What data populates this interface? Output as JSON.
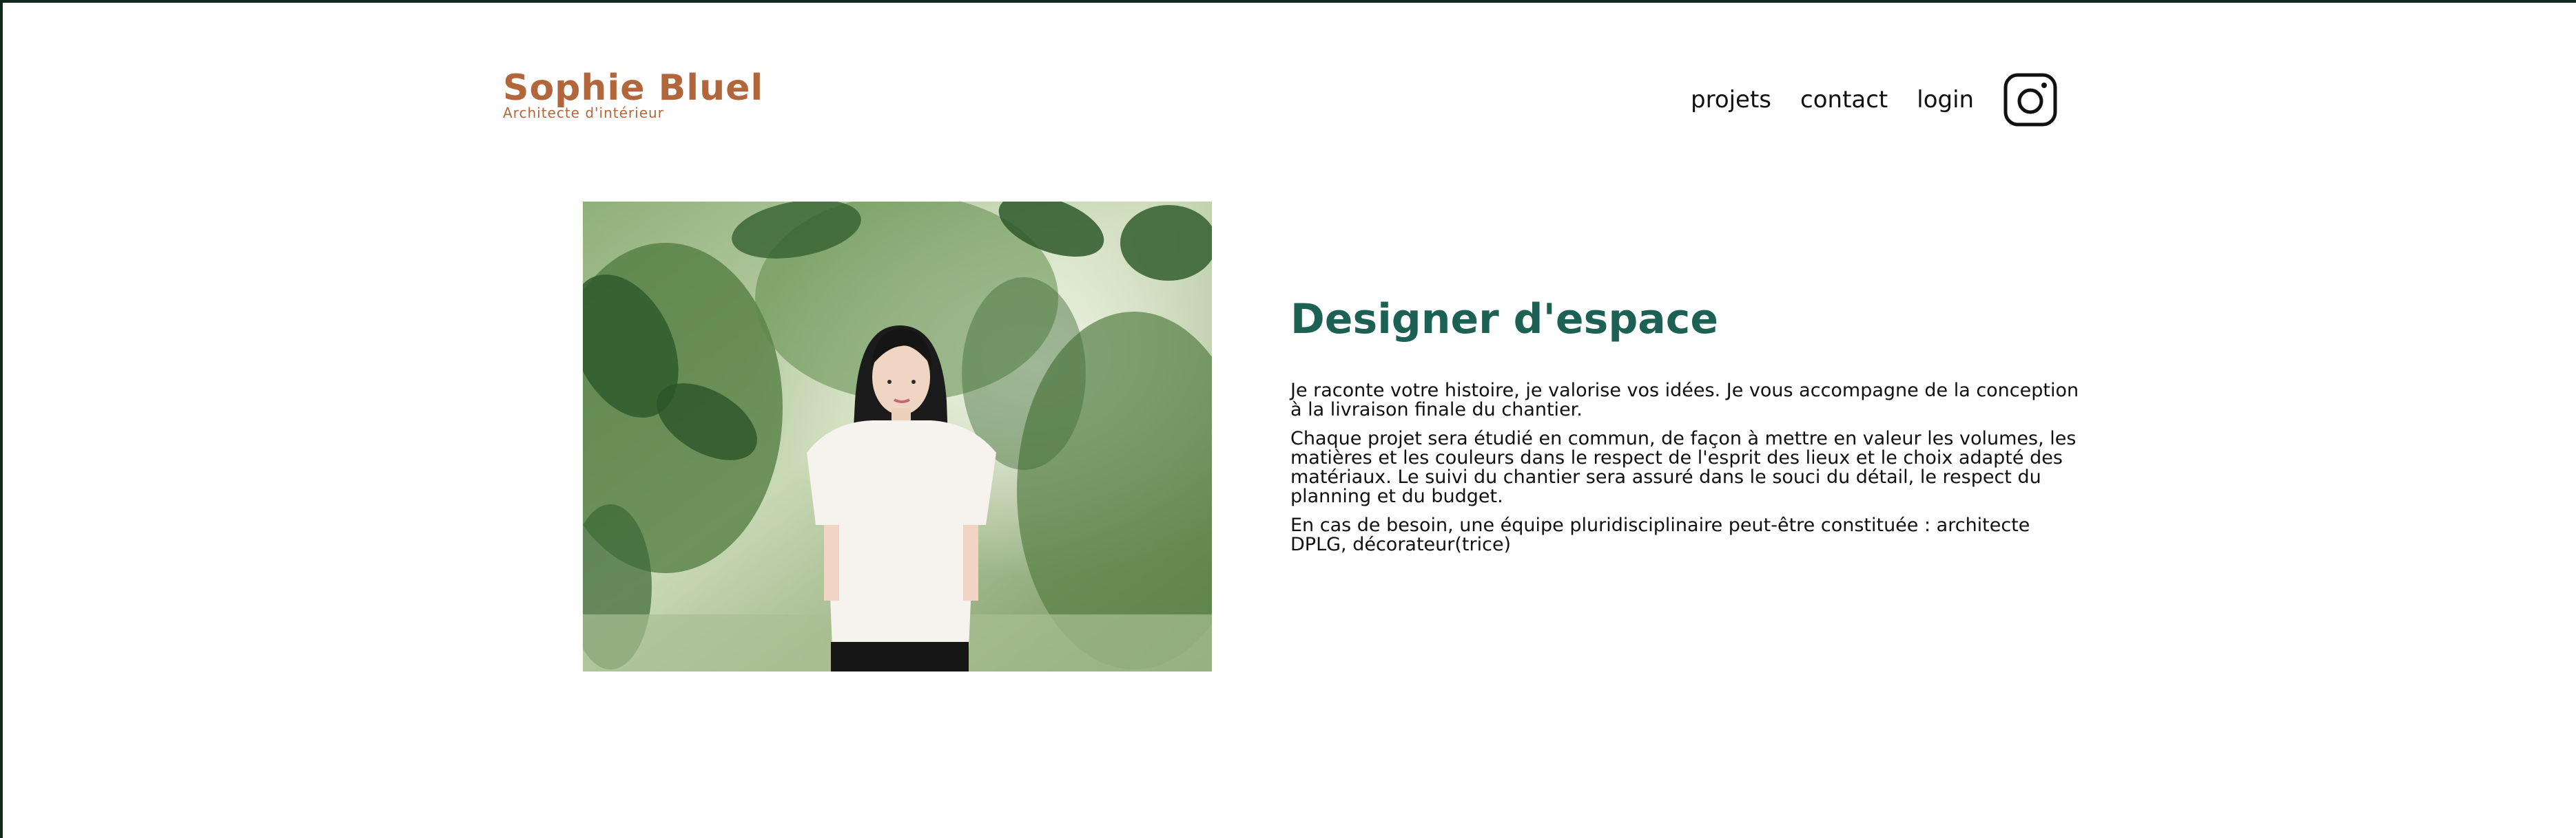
{
  "header": {
    "logo_title": "Sophie Bluel",
    "logo_subtitle": "Architecte d'intérieur",
    "nav": {
      "projects": "projets",
      "contact": "contact",
      "login": "login"
    },
    "instagram_icon": "instagram-icon"
  },
  "intro": {
    "image_alt": "Sophie Bluel",
    "title": "Designer d'espace",
    "paragraphs": [
      "Je raconte votre histoire, je valorise vos idées. Je vous accompagne de la conception à la livraison finale du chantier.",
      "Chaque projet sera étudié en commun, de façon à mettre en valeur les volumes, les matières et les couleurs dans le respect de l'esprit des lieux et le choix adapté des matériaux. Le suivi du chantier sera assuré dans le souci du détail, le respect du planning et du budget.",
      "En cas de besoin, une équipe pluridisciplinaire peut-être constituée : architecte DPLG, décorateur(trice)"
    ]
  },
  "colors": {
    "brand": "#B1663C",
    "accent": "#1D6154",
    "text": "#111111"
  }
}
